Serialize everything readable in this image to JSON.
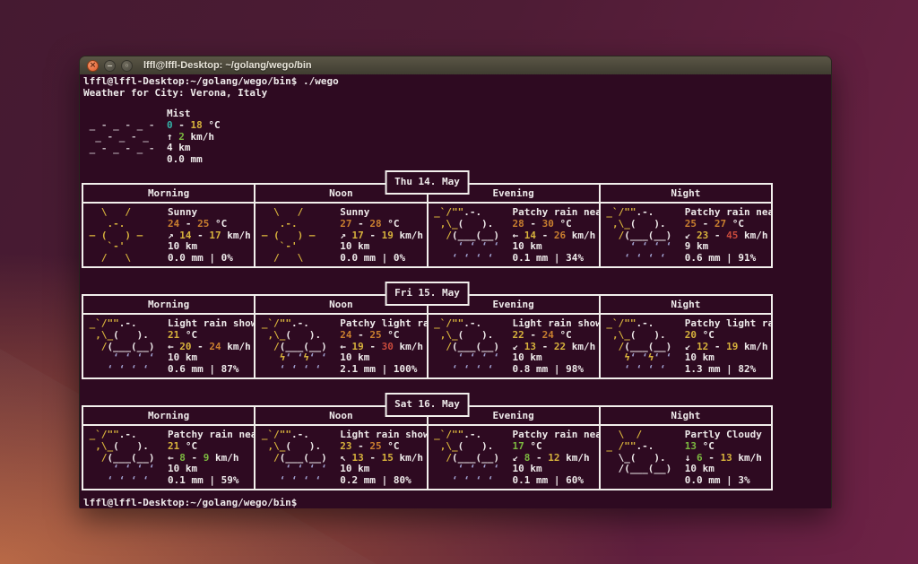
{
  "window": {
    "title": "lffl@lffl-Desktop: ~/golang/wego/bin",
    "controls": {
      "close": "×",
      "minimize": "−",
      "maximize": "◦"
    }
  },
  "terminal": {
    "prompt": "lffl@lffl-Desktop:~/golang/wego/bin$",
    "command": "./wego",
    "city_line": "Weather for City: Verona, Italy",
    "final_prompt": "lffl@lffl-Desktop:~/golang/wego/bin$"
  },
  "colors": {
    "term-bg": "#2e0a21",
    "border": "#f2efec",
    "c-w": "#eeeaea",
    "c-y": "#d7b23c",
    "c-o": "#c97f2f",
    "c-r": "#c94a3c",
    "c-g": "#7cb940",
    "c-c": "#33b1a7",
    "c-b": "#9f9fce",
    "c-gy": "#beb3ba"
  },
  "column_headers": [
    "Morning",
    "Noon",
    "Evening",
    "Night"
  ],
  "current": {
    "icon": "mist",
    "condition": "Mist",
    "temp": [
      [
        "c",
        "0"
      ],
      [
        "w",
        " - "
      ],
      [
        "y",
        "18"
      ],
      [
        "w",
        " °C"
      ]
    ],
    "wind": [
      [
        "w",
        "↑ "
      ],
      [
        "g",
        "2"
      ],
      [
        "w",
        " km/h"
      ]
    ],
    "visibility": "4 km",
    "precip": "0.0 mm"
  },
  "days": [
    {
      "date": "Thu 14. May",
      "cells": [
        {
          "icon": "sunny",
          "condition": "Sunny",
          "temp": [
            [
              "o",
              "24"
            ],
            [
              "w",
              " - "
            ],
            [
              "o",
              "25"
            ],
            [
              "w",
              " °C"
            ]
          ],
          "wind": [
            [
              "w",
              "↗ "
            ],
            [
              "y",
              "14"
            ],
            [
              "w",
              " - "
            ],
            [
              "y",
              "17"
            ],
            [
              "w",
              " km/h"
            ]
          ],
          "visibility": "10 km",
          "precip": "0.0 mm | 0%"
        },
        {
          "icon": "sunny",
          "condition": "Sunny",
          "temp": [
            [
              "o",
              "27"
            ],
            [
              "w",
              " - "
            ],
            [
              "o",
              "28"
            ],
            [
              "w",
              " °C"
            ]
          ],
          "wind": [
            [
              "w",
              "↗ "
            ],
            [
              "y",
              "17"
            ],
            [
              "w",
              " - "
            ],
            [
              "y",
              "19"
            ],
            [
              "w",
              " km/h"
            ]
          ],
          "visibility": "10 km",
          "precip": "0.0 mm | 0%"
        },
        {
          "icon": "rain",
          "condition": "Patchy rain nea",
          "temp": [
            [
              "o",
              "28"
            ],
            [
              "w",
              " - "
            ],
            [
              "o",
              "30"
            ],
            [
              "w",
              " °C"
            ]
          ],
          "wind": [
            [
              "w",
              "← "
            ],
            [
              "y",
              "14"
            ],
            [
              "w",
              " - "
            ],
            [
              "o",
              "26"
            ],
            [
              "w",
              " km/h"
            ]
          ],
          "visibility": "10 km",
          "precip": "0.1 mm | 34%"
        },
        {
          "icon": "rain",
          "condition": "Patchy rain nea",
          "temp": [
            [
              "o",
              "25"
            ],
            [
              "w",
              " - "
            ],
            [
              "o",
              "27"
            ],
            [
              "w",
              " °C"
            ]
          ],
          "wind": [
            [
              "w",
              "↙ "
            ],
            [
              "y",
              "23"
            ],
            [
              "w",
              " - "
            ],
            [
              "r",
              "45"
            ],
            [
              "w",
              " km/h"
            ]
          ],
          "visibility": "9 km",
          "precip": "0.6 mm | 91%"
        }
      ]
    },
    {
      "date": "Fri 15. May",
      "cells": [
        {
          "icon": "rain",
          "condition": "Light rain show",
          "temp": [
            [
              "y",
              "21"
            ],
            [
              "w",
              " °C"
            ]
          ],
          "wind": [
            [
              "w",
              "← "
            ],
            [
              "y",
              "20"
            ],
            [
              "w",
              " - "
            ],
            [
              "o",
              "24"
            ],
            [
              "w",
              " km/h"
            ]
          ],
          "visibility": "10 km",
          "precip": "0.6 mm | 87%"
        },
        {
          "icon": "thunder",
          "condition": "Patchy light ra",
          "temp": [
            [
              "o",
              "24"
            ],
            [
              "w",
              " - "
            ],
            [
              "o",
              "25"
            ],
            [
              "w",
              " °C"
            ]
          ],
          "wind": [
            [
              "w",
              "← "
            ],
            [
              "y",
              "19"
            ],
            [
              "w",
              " - "
            ],
            [
              "r",
              "30"
            ],
            [
              "w",
              " km/h"
            ]
          ],
          "visibility": "10 km",
          "precip": "2.1 mm | 100%"
        },
        {
          "icon": "rain",
          "condition": "Light rain show",
          "temp": [
            [
              "y",
              "22"
            ],
            [
              "w",
              " - "
            ],
            [
              "o",
              "24"
            ],
            [
              "w",
              " °C"
            ]
          ],
          "wind": [
            [
              "w",
              "↙ "
            ],
            [
              "y",
              "13"
            ],
            [
              "w",
              " - "
            ],
            [
              "y",
              "22"
            ],
            [
              "w",
              " km/h"
            ]
          ],
          "visibility": "10 km",
          "precip": "0.8 mm | 98%"
        },
        {
          "icon": "thunder",
          "condition": "Patchy light ra",
          "temp": [
            [
              "y",
              "20"
            ],
            [
              "w",
              " °C"
            ]
          ],
          "wind": [
            [
              "w",
              "↙ "
            ],
            [
              "y",
              "12"
            ],
            [
              "w",
              " - "
            ],
            [
              "y",
              "19"
            ],
            [
              "w",
              " km/h"
            ]
          ],
          "visibility": "10 km",
          "precip": "1.3 mm | 82%"
        }
      ]
    },
    {
      "date": "Sat 16. May",
      "cells": [
        {
          "icon": "rain",
          "condition": "Patchy rain nea",
          "temp": [
            [
              "y",
              "21"
            ],
            [
              "w",
              " °C"
            ]
          ],
          "wind": [
            [
              "w",
              "← "
            ],
            [
              "g",
              "8"
            ],
            [
              "w",
              " - "
            ],
            [
              "g",
              "9"
            ],
            [
              "w",
              " km/h"
            ]
          ],
          "visibility": "10 km",
          "precip": "0.1 mm | 59%"
        },
        {
          "icon": "rain",
          "condition": "Light rain show",
          "temp": [
            [
              "y",
              "23"
            ],
            [
              "w",
              " - "
            ],
            [
              "o",
              "25"
            ],
            [
              "w",
              " °C"
            ]
          ],
          "wind": [
            [
              "w",
              "↖ "
            ],
            [
              "y",
              "13"
            ],
            [
              "w",
              " - "
            ],
            [
              "y",
              "15"
            ],
            [
              "w",
              " km/h"
            ]
          ],
          "visibility": "10 km",
          "precip": "0.2 mm | 80%"
        },
        {
          "icon": "rain",
          "condition": "Patchy rain nea",
          "temp": [
            [
              "g",
              "17"
            ],
            [
              "w",
              " °C"
            ]
          ],
          "wind": [
            [
              "w",
              "↙ "
            ],
            [
              "g",
              "8"
            ],
            [
              "w",
              " - "
            ],
            [
              "y",
              "12"
            ],
            [
              "w",
              " km/h"
            ]
          ],
          "visibility": "10 km",
          "precip": "0.1 mm | 60%"
        },
        {
          "icon": "partly_cloudy",
          "condition": "Partly Cloudy",
          "temp": [
            [
              "g",
              "13"
            ],
            [
              "w",
              " °C"
            ]
          ],
          "wind": [
            [
              "w",
              "↓ "
            ],
            [
              "g",
              "6"
            ],
            [
              "w",
              " - "
            ],
            [
              "y",
              "13"
            ],
            [
              "w",
              " km/h"
            ]
          ],
          "visibility": "10 km",
          "precip": "0.0 mm | 3%"
        }
      ]
    }
  ],
  "icons": {
    "mist": [
      [
        [
          "gy",
          " _ - _ - _ -"
        ]
      ],
      [
        [
          "gy",
          "  _ - _ - _"
        ]
      ],
      [
        [
          "gy",
          " _ - _ - _ -"
        ]
      ]
    ],
    "sunny": [
      [
        [
          "y",
          "   \\   /"
        ]
      ],
      [
        [
          "y",
          "    .-."
        ]
      ],
      [
        [
          "y",
          " – (   ) –"
        ]
      ],
      [
        [
          "y",
          "    `-'"
        ]
      ],
      [
        [
          "y",
          "   /   \\"
        ]
      ]
    ],
    "rain": [
      [
        [
          "y",
          " _`/\"\""
        ],
        [
          "w",
          ".-."
        ]
      ],
      [
        [
          "y",
          "  ,\\_"
        ],
        [
          "w",
          "(   )."
        ]
      ],
      [
        [
          "y",
          "   /"
        ],
        [
          "w",
          "(___(__)"
        ]
      ],
      [
        [
          "b",
          "     ‘ ‘ ‘ ‘"
        ]
      ],
      [
        [
          "b",
          "    ‘ ‘ ‘ ‘"
        ]
      ]
    ],
    "thunder": [
      [
        [
          "y",
          " _`/\"\""
        ],
        [
          "w",
          ".-."
        ]
      ],
      [
        [
          "y",
          "  ,\\_"
        ],
        [
          "w",
          "(   )."
        ]
      ],
      [
        [
          "y",
          "   /"
        ],
        [
          "w",
          "(___(__)"
        ]
      ],
      [
        [
          "b",
          "    "
        ],
        [
          "y",
          "ϟ"
        ],
        [
          "b",
          "‘ ‘"
        ],
        [
          "y",
          "ϟ"
        ],
        [
          "b",
          "‘ ‘"
        ]
      ],
      [
        [
          "b",
          "    ‘ ‘ ‘ ‘"
        ]
      ]
    ],
    "partly_cloudy": [
      [
        [
          "y",
          "   \\  /"
        ]
      ],
      [
        [
          "y",
          " _ /\"\""
        ],
        [
          "w",
          ".-."
        ]
      ],
      [
        [
          "w",
          "   \\_(   )."
        ]
      ],
      [
        [
          "w",
          "   /(___(__)"
        ]
      ]
    ]
  }
}
